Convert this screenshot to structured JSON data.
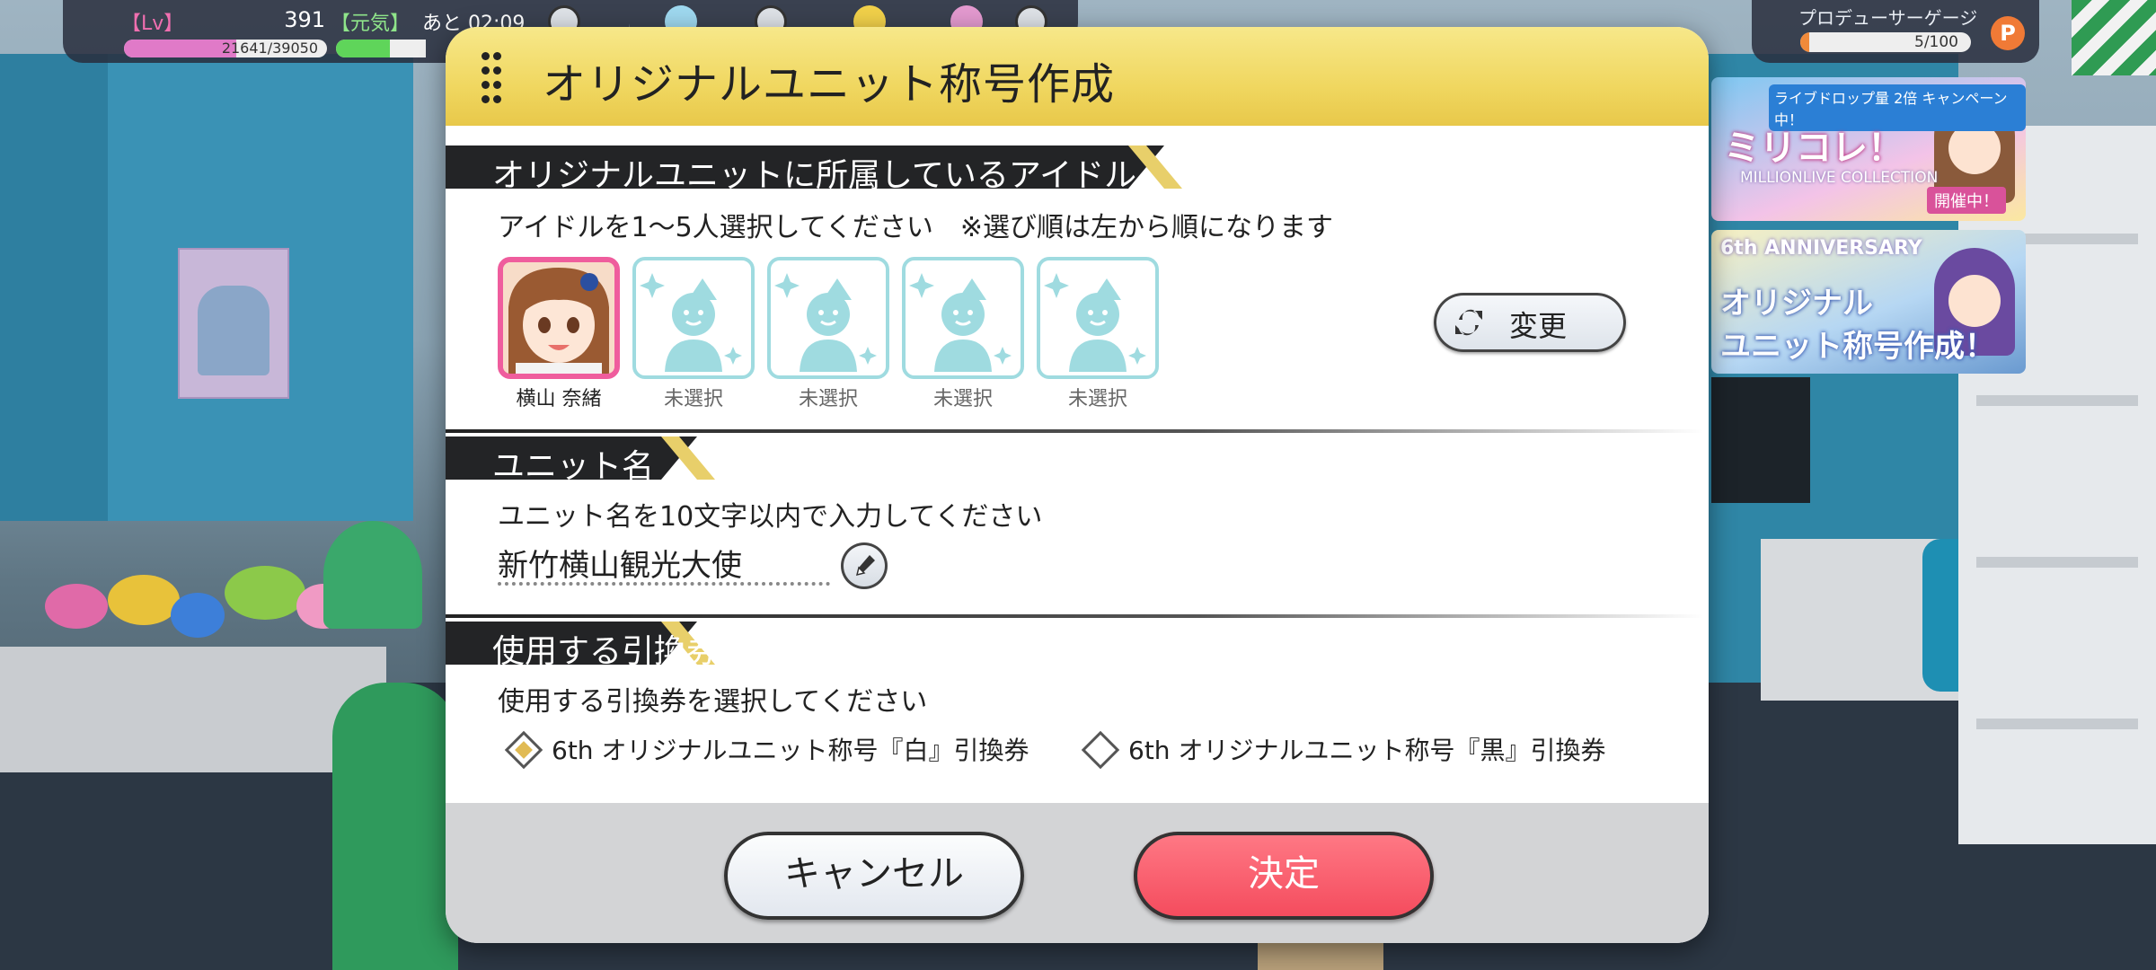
{
  "hud": {
    "lv_label": "【Lv】",
    "level": "391",
    "stamina_label": "【元気】",
    "stamina_time": "あと 02:09",
    "xp_text": "21641/39050",
    "xp_fraction": 0.554,
    "stamina_fraction": 0.6,
    "producer_gauge_label": "プロデューサーゲージ",
    "producer_gauge_text": "5/100",
    "producer_gauge_fraction": 0.05,
    "producer_icon": "P"
  },
  "banners": [
    {
      "sub": "ライブドロップ量 2倍 キャンペーン中！",
      "main": "ミリコレ！",
      "sub2": "MILLIONLIVE COLLECTION",
      "tag": "開催中！"
    },
    {
      "ann": "6th ANNIVERSARY",
      "line1": "オリジナル",
      "line2": "ユニット称号作成！"
    }
  ],
  "dialog": {
    "title": "オリジナルユニット称号作成",
    "idol_section": {
      "heading": "オリジナルユニットに所属しているアイドル",
      "hint": "アイドルを1～5人選択してください　※選び順は左から順になります",
      "slots": [
        {
          "label": "横山 奈緒",
          "selected": true
        },
        {
          "label": "未選択",
          "selected": false
        },
        {
          "label": "未選択",
          "selected": false
        },
        {
          "label": "未選択",
          "selected": false
        },
        {
          "label": "未選択",
          "selected": false
        }
      ],
      "change_button": "変更"
    },
    "unit_name_section": {
      "heading": "ユニット名",
      "hint": "ユニット名を10文字以内で入力してください",
      "value": "新竹横山観光大使"
    },
    "ticket_section": {
      "heading": "使用する引換券",
      "hint": "使用する引換券を選択してください",
      "options": [
        {
          "label": "6th オリジナルユニット称号『白』引換券",
          "selected": true
        },
        {
          "label": "6th オリジナルユニット称号『黒』引換券",
          "selected": false
        }
      ]
    },
    "cancel_button": "キャンセル",
    "confirm_button": "決定"
  },
  "colors": {
    "header_gold": "#f0d760",
    "selected_border": "#ef5d9d",
    "empty_border": "#9fdbe0",
    "confirm_red": "#f44a5c"
  }
}
